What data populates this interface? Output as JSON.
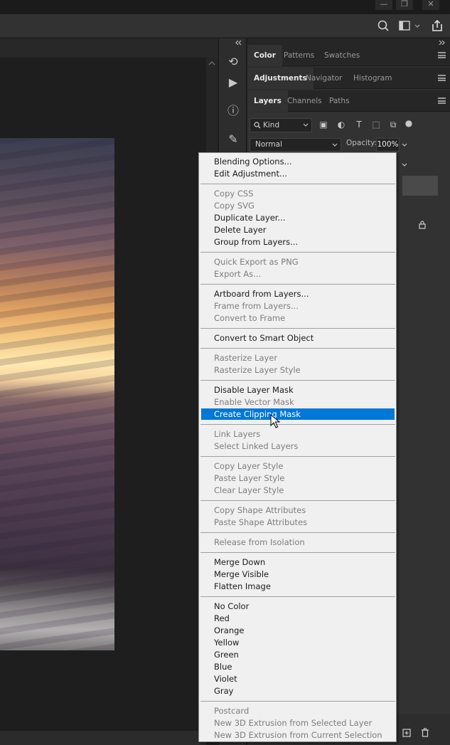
{
  "layers_panel": {
    "tab_groups": [
      [
        "Color",
        "Patterns",
        "Swatches"
      ],
      [
        "Adjustments",
        "Navigator",
        "Histogram"
      ],
      [
        "Layers",
        "Channels",
        "Paths"
      ]
    ],
    "kind_filter": "Kind",
    "blend_mode": "Normal",
    "opacity_label": "Opacity:",
    "opacity_value": "100%"
  },
  "context_menu": {
    "highlighted": "Create Clipping Mask",
    "groups": [
      [
        {
          "label": "Blending Options...",
          "enabled": true
        },
        {
          "label": "Edit Adjustment...",
          "enabled": true
        }
      ],
      [
        {
          "label": "Copy CSS",
          "enabled": false
        },
        {
          "label": "Copy SVG",
          "enabled": false
        },
        {
          "label": "Duplicate Layer...",
          "enabled": true
        },
        {
          "label": "Delete Layer",
          "enabled": true
        },
        {
          "label": "Group from Layers...",
          "enabled": true
        }
      ],
      [
        {
          "label": "Quick Export as PNG",
          "enabled": false
        },
        {
          "label": "Export As...",
          "enabled": false
        }
      ],
      [
        {
          "label": "Artboard from Layers...",
          "enabled": true
        },
        {
          "label": "Frame from Layers...",
          "enabled": false
        },
        {
          "label": "Convert to Frame",
          "enabled": false
        }
      ],
      [
        {
          "label": "Convert to Smart Object",
          "enabled": true
        }
      ],
      [
        {
          "label": "Rasterize Layer",
          "enabled": false
        },
        {
          "label": "Rasterize Layer Style",
          "enabled": false
        }
      ],
      [
        {
          "label": "Disable Layer Mask",
          "enabled": true
        },
        {
          "label": "Enable Vector Mask",
          "enabled": false
        },
        {
          "label": "Create Clipping Mask",
          "enabled": true
        }
      ],
      [
        {
          "label": "Link Layers",
          "enabled": false
        },
        {
          "label": "Select Linked Layers",
          "enabled": false
        }
      ],
      [
        {
          "label": "Copy Layer Style",
          "enabled": false
        },
        {
          "label": "Paste Layer Style",
          "enabled": false
        },
        {
          "label": "Clear Layer Style",
          "enabled": false
        }
      ],
      [
        {
          "label": "Copy Shape Attributes",
          "enabled": false
        },
        {
          "label": "Paste Shape Attributes",
          "enabled": false
        }
      ],
      [
        {
          "label": "Release from Isolation",
          "enabled": false
        }
      ],
      [
        {
          "label": "Merge Down",
          "enabled": true
        },
        {
          "label": "Merge Visible",
          "enabled": true
        },
        {
          "label": "Flatten Image",
          "enabled": true
        }
      ],
      [
        {
          "label": "No Color",
          "enabled": true
        },
        {
          "label": "Red",
          "enabled": true
        },
        {
          "label": "Orange",
          "enabled": true
        },
        {
          "label": "Yellow",
          "enabled": true
        },
        {
          "label": "Green",
          "enabled": true
        },
        {
          "label": "Blue",
          "enabled": true
        },
        {
          "label": "Violet",
          "enabled": true
        },
        {
          "label": "Gray",
          "enabled": true
        }
      ],
      [
        {
          "label": "Postcard",
          "enabled": false
        },
        {
          "label": "New 3D Extrusion from Selected Layer",
          "enabled": false
        },
        {
          "label": "New 3D Extrusion from Current Selection",
          "enabled": false
        }
      ]
    ]
  },
  "colors": {
    "highlight": "#0078d7",
    "menu_bg": "#f0f0f0",
    "panel_bg": "#323232"
  }
}
